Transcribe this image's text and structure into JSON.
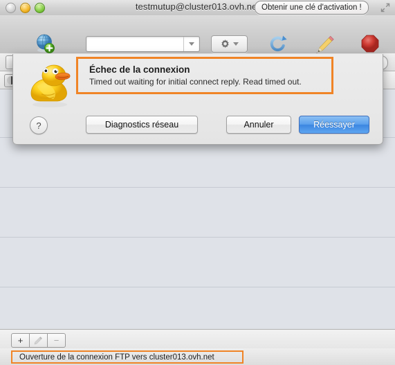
{
  "window": {
    "title": "testmutup@cluster013.ovh.net",
    "activation_badge": "Obtenir une clé d'activation !",
    "traffic_lights": [
      "close-button",
      "minimize-button",
      "zoom-button"
    ],
    "fullscreen_icon": "fullscreen-icon"
  },
  "toolbar": {
    "items": [
      {
        "label": "Nouvelle connexion",
        "icon": "new-connection-icon",
        "dimmed": false
      },
      {
        "label": "Connexion rapide",
        "icon": "quick-connect-combobox",
        "dimmed": true
      },
      {
        "label": "Action",
        "icon": "gear-icon",
        "dimmed": true
      },
      {
        "label": "Actualiser",
        "icon": "refresh-icon",
        "dimmed": true
      },
      {
        "label": "Édition",
        "icon": "pencil-icon",
        "dimmed": false
      },
      {
        "label": "Arrêter",
        "icon": "stop-octagon-icon",
        "dimmed": false
      }
    ],
    "quick_connect_value": "",
    "quick_connect_placeholder": ""
  },
  "browser": {
    "nav_back_icon": "chevron-left-icon",
    "nav_forward_icon": "chevron-right-icon",
    "search_value": "",
    "search_placeholder": "",
    "path_toggle_icon": "disclosure-toggle-icon",
    "row_count": 5
  },
  "dialog": {
    "icon": "rubber-duck-icon",
    "title": "Échec de la connexion",
    "message": "Timed out waiting for initial connect reply. Read timed out.",
    "help_label": "?",
    "buttons": {
      "diagnostics": "Diagnostics réseau",
      "cancel": "Annuler",
      "retry": "Réessayer"
    },
    "highlight_color": "#f08426"
  },
  "bottom_toolbar": {
    "add_label": "+",
    "edit_icon": "pencil-icon",
    "remove_label": "−"
  },
  "statusbar": {
    "text": "Ouverture de la connexion FTP vers cluster013.ovh.net",
    "highlight_color": "#f08426"
  }
}
